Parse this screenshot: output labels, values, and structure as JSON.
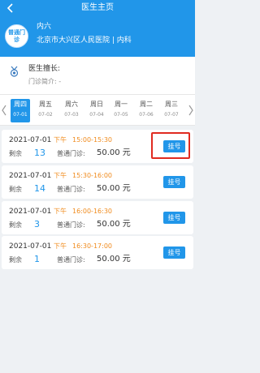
{
  "header": {
    "title": "医生主页"
  },
  "doctor": {
    "badge_text": "普通门诊",
    "name": "内六",
    "hospital_dept": "北京市大兴区人民医院 | 内科"
  },
  "info": {
    "specialty_label": "医生擅长:",
    "intro_label": "门诊简介: -"
  },
  "days": [
    {
      "dow": "周四",
      "date": "07-01"
    },
    {
      "dow": "周五",
      "date": "07-02"
    },
    {
      "dow": "周六",
      "date": "07-03"
    },
    {
      "dow": "周日",
      "date": "07-04"
    },
    {
      "dow": "周一",
      "date": "07-05"
    },
    {
      "dow": "周二",
      "date": "07-06"
    },
    {
      "dow": "周三",
      "date": "07-07"
    }
  ],
  "selected_day_index": 0,
  "slots": [
    {
      "date": "2021-07-01",
      "period": "下午",
      "time": "15:00-15:30",
      "remain_label": "剩余",
      "remain": "13",
      "type": "普通门诊:",
      "price": "50.00 元",
      "book_label": "挂号"
    },
    {
      "date": "2021-07-01",
      "period": "下午",
      "time": "15:30-16:00",
      "remain_label": "剩余",
      "remain": "14",
      "type": "普通门诊:",
      "price": "50.00 元",
      "book_label": "挂号"
    },
    {
      "date": "2021-07-01",
      "period": "下午",
      "time": "16:00-16:30",
      "remain_label": "剩余",
      "remain": "3",
      "type": "普通门诊:",
      "price": "50.00 元",
      "book_label": "挂号"
    },
    {
      "date": "2021-07-01",
      "period": "下午",
      "time": "16:30-17:00",
      "remain_label": "剩余",
      "remain": "1",
      "type": "普通门诊:",
      "price": "50.00 元",
      "book_label": "挂号"
    }
  ],
  "colors": {
    "primary": "#2196e9",
    "accent_orange": "#f08b1d",
    "highlight_red": "#e02b20"
  },
  "icons": {
    "back": "chevron-left-icon",
    "specialty": "medal-icon",
    "prev": "chevron-left-icon",
    "next": "chevron-right-icon"
  }
}
